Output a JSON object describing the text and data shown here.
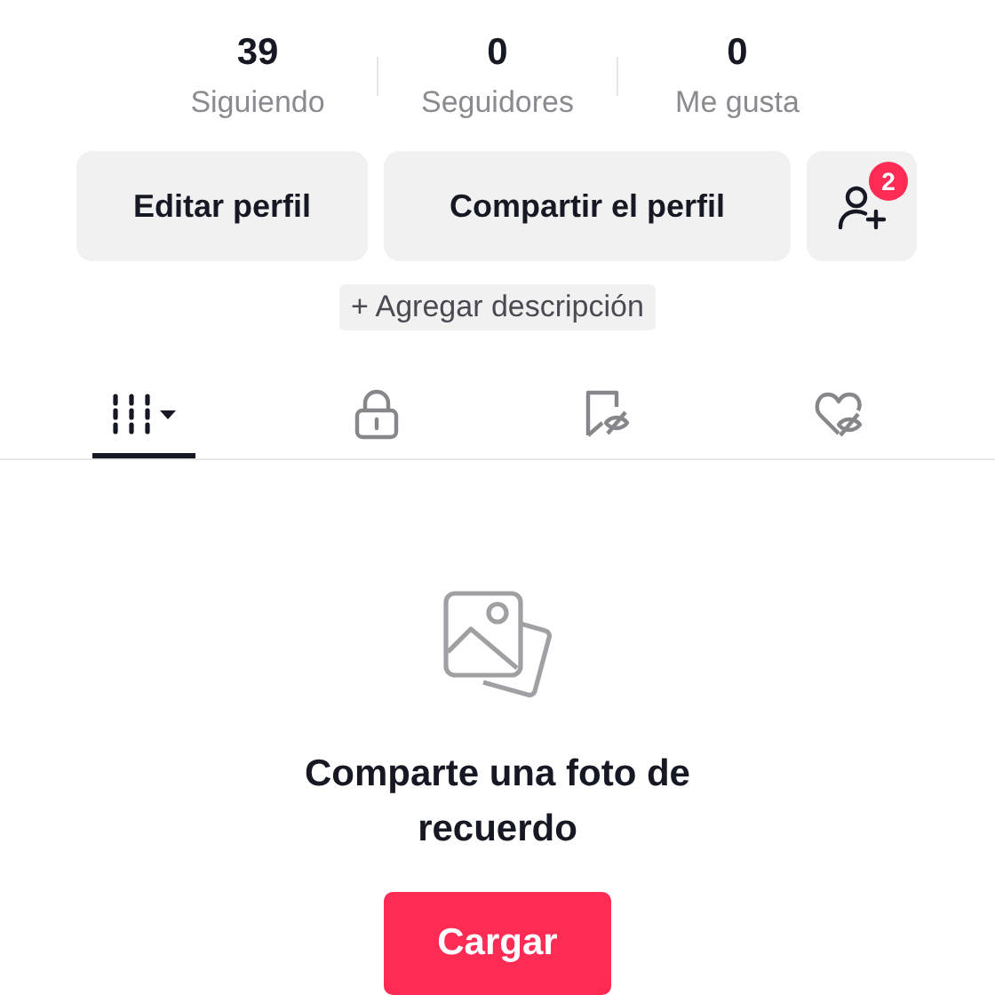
{
  "stats": [
    {
      "value": "39",
      "label": "Siguiendo"
    },
    {
      "value": "0",
      "label": "Seguidores"
    },
    {
      "value": "0",
      "label": "Me gusta"
    }
  ],
  "actions": {
    "edit": "Editar perfil",
    "share": "Compartir el perfil",
    "friends_badge": "2"
  },
  "add_description": "+ Agregar descripción",
  "tabs": [
    {
      "kind": "videos",
      "selected": true
    },
    {
      "kind": "private",
      "selected": false
    },
    {
      "kind": "saved",
      "selected": false
    },
    {
      "kind": "liked",
      "selected": false
    }
  ],
  "empty_state": {
    "message": "Comparte una foto de recuerdo",
    "button": "Cargar"
  }
}
